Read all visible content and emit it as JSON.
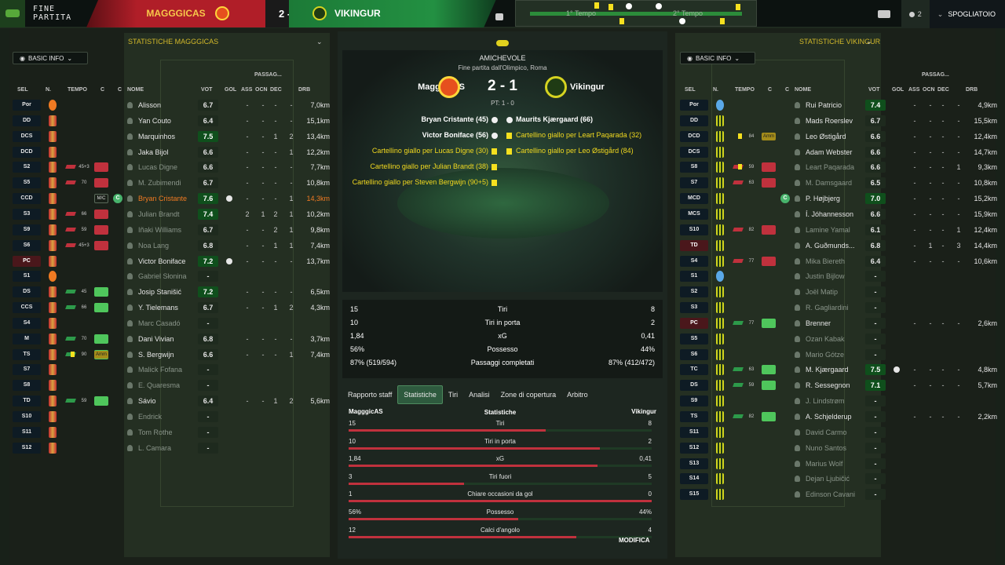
{
  "topbar": {
    "fine": "FINE PARTITA",
    "home": "MAGGGICAS",
    "score": "2 - 1",
    "away": "VIKINGUR",
    "tempo1": "1° Tempo",
    "tempo2": "2° Tempo",
    "users": "2",
    "spogliatoio": "SPOGLIATOIO"
  },
  "left": {
    "title": "STATISTICHE MAGGGICAS",
    "basic": "BASIC INFO",
    "headers": {
      "sel": "SEL",
      "n": "N.",
      "tempo": "TEMPO",
      "c1": "C",
      "c2": "C",
      "nome": "NOME",
      "vot": "VOT",
      "gol": "GOL",
      "ass": "ASS",
      "ocn": "OCN",
      "dec": "DEC",
      "drb": "DRB",
      "passagg": "PASSAG..."
    },
    "rows": [
      {
        "sel": "Por",
        "gk": true,
        "nm": "Alisson",
        "v": "6.7",
        "gol": "-",
        "ass": "-",
        "ocn": "-",
        "dec": "-",
        "drb": "7,0km"
      },
      {
        "sel": "DD",
        "nm": "Yan Couto",
        "v": "6.4",
        "gol": "-",
        "ass": "-",
        "ocn": "-",
        "dec": "-",
        "drb": "15,1km"
      },
      {
        "sel": "DCS",
        "nm": "Marquinhos",
        "v": "7.5",
        "g": true,
        "gol": "-",
        "ass": "-",
        "ocn": "1",
        "dec": "2",
        "drb": "13,4km"
      },
      {
        "sel": "DCD",
        "nm": "Jaka Bijol",
        "v": "6.6",
        "gol": "-",
        "ass": "-",
        "ocn": "-",
        "dec": "1",
        "drb": "12,2km"
      },
      {
        "sel": "S2",
        "t": "45+3",
        "out": true,
        "dim": true,
        "nm": "Lucas Digne",
        "v": "6.6",
        "gol": "-",
        "ass": "-",
        "ocn": "-",
        "dec": "-",
        "drb": "7,7km"
      },
      {
        "sel": "S5",
        "t": "70",
        "out": true,
        "dim": true,
        "nm": "M. Zubimendi",
        "v": "6.7",
        "gol": "-",
        "ass": "-",
        "ocn": "-",
        "dec": "-",
        "drb": "10,8km"
      },
      {
        "sel": "CCD",
        "mic": "M/C",
        "cap": "C",
        "hl": true,
        "nm": "Bryan Cristante",
        "v": "7.6",
        "g": true,
        "goal": true,
        "gol": "-",
        "ass": "-",
        "ocn": "-",
        "dec": "1",
        "drb": "14,3km"
      },
      {
        "sel": "S3",
        "t": "66",
        "out": true,
        "dim": true,
        "nm": "Julian Brandt",
        "v": "7.4",
        "g": true,
        "gol": "2",
        "ass": "1",
        "ocn": "2",
        "dec": "1",
        "drb": "10,2km"
      },
      {
        "sel": "S9",
        "t": "59",
        "out": true,
        "dim": true,
        "nm": "Iñaki Williams",
        "v": "6.7",
        "gol": "-",
        "ass": "-",
        "ocn": "2",
        "dec": "1",
        "drb": "9,8km"
      },
      {
        "sel": "S6",
        "t": "45+3",
        "out": true,
        "dim": true,
        "nm": "Noa Lang",
        "v": "6.8",
        "gol": "-",
        "ass": "-",
        "ocn": "1",
        "dec": "1",
        "drb": "7,4km"
      },
      {
        "sel": "PC",
        "red": true,
        "nm": "Victor Boniface",
        "v": "7.2",
        "g": true,
        "goal": true,
        "gol": "-",
        "ass": "-",
        "ocn": "-",
        "dec": "-",
        "drb": "13,7km"
      },
      {
        "sel": "S1",
        "gk": true,
        "dim": true,
        "nm": "Gabriel Słonina",
        "v": "-",
        "gol": "",
        "ass": "",
        "ocn": "",
        "dec": "",
        "drb": ""
      },
      {
        "sel": "DS",
        "t": "45",
        "in": true,
        "nm": "Josip Stanišić",
        "v": "7.2",
        "g": true,
        "gol": "-",
        "ass": "-",
        "ocn": "-",
        "dec": "-",
        "drb": "6,5km"
      },
      {
        "sel": "CCS",
        "t": "66",
        "in": true,
        "nm": "Y. Tielemans",
        "v": "6.7",
        "gol": "-",
        "ass": "-",
        "ocn": "1",
        "dec": "2",
        "drb": "4,3km"
      },
      {
        "sel": "S4",
        "dim": true,
        "nm": "Marc Casadó",
        "v": "-",
        "gol": "",
        "ass": "",
        "ocn": "",
        "dec": "",
        "drb": ""
      },
      {
        "sel": "M",
        "t": "70",
        "in": true,
        "nm": "Dani Vivian",
        "v": "6.8",
        "gol": "-",
        "ass": "-",
        "ocn": "-",
        "dec": "-",
        "drb": "3,7km"
      },
      {
        "sel": "TS",
        "t": "90",
        "in": true,
        "yc": true,
        "amm": "Amm",
        "nm": "S. Bergwijn",
        "v": "6.6",
        "gol": "-",
        "ass": "-",
        "ocn": "-",
        "dec": "1",
        "drb": "7,4km"
      },
      {
        "sel": "S7",
        "dim": true,
        "nm": "Malick Fofana",
        "v": "-",
        "gol": "",
        "ass": "",
        "ocn": "",
        "dec": "",
        "drb": ""
      },
      {
        "sel": "S8",
        "dim": true,
        "nm": "E. Quaresma",
        "v": "-",
        "gol": "",
        "ass": "",
        "ocn": "",
        "dec": "",
        "drb": ""
      },
      {
        "sel": "TD",
        "t": "59",
        "in": true,
        "nm": "Sávio",
        "v": "6.4",
        "gol": "-",
        "ass": "-",
        "ocn": "1",
        "dec": "2",
        "drb": "5,6km"
      },
      {
        "sel": "S10",
        "dim": true,
        "nm": "Endrick",
        "v": "-",
        "gol": "",
        "ass": "",
        "ocn": "",
        "dec": "",
        "drb": ""
      },
      {
        "sel": "S11",
        "dim": true,
        "nm": "Tom Rothe",
        "v": "-",
        "gol": "",
        "ass": "",
        "ocn": "",
        "dec": "",
        "drb": ""
      },
      {
        "sel": "S12",
        "dim": true,
        "nm": "L. Camara",
        "v": "-",
        "gol": "",
        "ass": "",
        "ocn": "",
        "dec": "",
        "drb": ""
      }
    ]
  },
  "right": {
    "title": "STATISTICHE VIKINGUR",
    "basic": "BASIC INFO",
    "rows": [
      {
        "sel": "Por",
        "gk": true,
        "nm": "Rui Patricio",
        "v": "7.4",
        "g": true,
        "gol": "-",
        "ass": "-",
        "ocn": "-",
        "dec": "-",
        "drb": "4,9km"
      },
      {
        "sel": "DD",
        "nm": "Mads Roerslev",
        "v": "6.7",
        "gol": "-",
        "ass": "-",
        "ocn": "-",
        "dec": "-",
        "drb": "15,5km"
      },
      {
        "sel": "DCD",
        "yc": true,
        "t": "84",
        "amm": "Amm",
        "nm": "Leo Østigård",
        "v": "6.6",
        "gol": "-",
        "ass": "-",
        "ocn": "-",
        "dec": "-",
        "drb": "12,4km"
      },
      {
        "sel": "DCS",
        "nm": "Adam Webster",
        "v": "6.6",
        "gol": "-",
        "ass": "-",
        "ocn": "-",
        "dec": "-",
        "drb": "14,7km"
      },
      {
        "sel": "S8",
        "yc": true,
        "t": "59",
        "out": true,
        "dim": true,
        "nm": "Leart Paqarada",
        "v": "6.6",
        "gol": "-",
        "ass": "-",
        "ocn": "-",
        "dec": "1",
        "drb": "9,3km"
      },
      {
        "sel": "S7",
        "t": "63",
        "out": true,
        "dim": true,
        "nm": "M. Damsgaard",
        "v": "6.5",
        "gol": "-",
        "ass": "-",
        "ocn": "-",
        "dec": "-",
        "drb": "10,8km"
      },
      {
        "sel": "MCD",
        "cap": "C",
        "nm": "P. Højbjerg",
        "v": "7.0",
        "g": true,
        "gol": "-",
        "ass": "-",
        "ocn": "-",
        "dec": "-",
        "drb": "15,2km"
      },
      {
        "sel": "MCS",
        "nm": "Í. Jóhannesson",
        "v": "6.6",
        "gol": "-",
        "ass": "-",
        "ocn": "-",
        "dec": "-",
        "drb": "15,9km"
      },
      {
        "sel": "S10",
        "t": "82",
        "out": true,
        "dim": true,
        "nm": "Lamine Yamal",
        "v": "6.1",
        "gol": "-",
        "ass": "-",
        "ocn": "-",
        "dec": "1",
        "drb": "12,4km"
      },
      {
        "sel": "TD",
        "red": true,
        "nm": "A. Guðmunds...",
        "v": "6.8",
        "gol": "-",
        "ass": "1",
        "ocn": "-",
        "dec": "3",
        "drb": "14,4km"
      },
      {
        "sel": "S4",
        "t": "77",
        "out": true,
        "dim": true,
        "nm": "Mika Biereth",
        "v": "6.4",
        "gol": "-",
        "ass": "-",
        "ocn": "-",
        "dec": "-",
        "drb": "10,6km"
      },
      {
        "sel": "S1",
        "gk": true,
        "dim": true,
        "nm": "Justin Bijlow",
        "v": "-",
        "gol": "",
        "ass": "",
        "ocn": "",
        "dec": "",
        "drb": ""
      },
      {
        "sel": "S2",
        "dim": true,
        "nm": "Joël Matip",
        "v": "-",
        "gol": "",
        "ass": "",
        "ocn": "",
        "dec": "",
        "drb": ""
      },
      {
        "sel": "S3",
        "dim": true,
        "nm": "R. Gagliardini",
        "v": "-",
        "gol": "",
        "ass": "",
        "ocn": "",
        "dec": "",
        "drb": ""
      },
      {
        "sel": "PC",
        "red": true,
        "t": "77",
        "in": true,
        "nm": "Brenner",
        "v": "-",
        "gol": "-",
        "ass": "-",
        "ocn": "-",
        "dec": "-",
        "drb": "2,6km"
      },
      {
        "sel": "S5",
        "dim": true,
        "nm": "Ozan Kabak",
        "v": "-",
        "gol": "",
        "ass": "",
        "ocn": "",
        "dec": "",
        "drb": ""
      },
      {
        "sel": "S6",
        "dim": true,
        "nm": "Mario Gótze",
        "v": "-",
        "gol": "",
        "ass": "",
        "ocn": "",
        "dec": "",
        "drb": ""
      },
      {
        "sel": "TC",
        "t": "63",
        "in": true,
        "nm": "M. Kjærgaard",
        "v": "7.5",
        "g": true,
        "goal": true,
        "gol": "-",
        "ass": "-",
        "ocn": "-",
        "dec": "-",
        "drb": "4,8km"
      },
      {
        "sel": "DS",
        "t": "59",
        "in": true,
        "nm": "R. Sessegnon",
        "v": "7.1",
        "g": true,
        "gol": "-",
        "ass": "-",
        "ocn": "-",
        "dec": "-",
        "drb": "5,7km"
      },
      {
        "sel": "S9",
        "dim": true,
        "nm": "J. Lindstrøm",
        "v": "-",
        "gol": "",
        "ass": "",
        "ocn": "",
        "dec": "",
        "drb": ""
      },
      {
        "sel": "TS",
        "t": "82",
        "in": true,
        "nm": "A. Schjelderup",
        "v": "-",
        "gol": "-",
        "ass": "-",
        "ocn": "-",
        "dec": "-",
        "drb": "2,2km"
      },
      {
        "sel": "S11",
        "dim": true,
        "nm": "David Carmo",
        "v": "-",
        "gol": "",
        "ass": "",
        "ocn": "",
        "dec": "",
        "drb": ""
      },
      {
        "sel": "S12",
        "dim": true,
        "nm": "Nuno Santos",
        "v": "-",
        "gol": "",
        "ass": "",
        "ocn": "",
        "dec": "",
        "drb": ""
      },
      {
        "sel": "S13",
        "dim": true,
        "nm": "Marius Wolf",
        "v": "-",
        "gol": "",
        "ass": "",
        "ocn": "",
        "dec": "",
        "drb": ""
      },
      {
        "sel": "S14",
        "dim": true,
        "nm": "Dejan Ljubičić",
        "v": "-",
        "gol": "",
        "ass": "",
        "ocn": "",
        "dec": "",
        "drb": ""
      },
      {
        "sel": "S15",
        "dim": true,
        "nm": "Edinson Cavani",
        "v": "-",
        "gol": "",
        "ass": "",
        "ocn": "",
        "dec": "",
        "drb": ""
      }
    ]
  },
  "match": {
    "competition": "AMICHEVOLE",
    "subtitle": "Fine partita dall'Olimpico, Roma",
    "home": "MagggicAS",
    "away": "Vikingur",
    "score": "2 - 1",
    "ht": "PT: 1 - 0",
    "events_left": [
      {
        "t": "Bryan Cristante (45)",
        "k": "goal"
      },
      {
        "t": "Victor Boniface (56)",
        "k": "goal"
      },
      {
        "t": "Cartellino giallo per Lucas Digne (30)",
        "k": "card"
      },
      {
        "t": "Cartellino giallo per Julian Brandt (38)",
        "k": "card"
      },
      {
        "t": "Cartellino giallo per Steven Bergwijn (90+5)",
        "k": "card"
      }
    ],
    "events_right": [
      {
        "t": "Maurits Kjærgaard (66)",
        "k": "goal"
      },
      {
        "t": "Cartellino giallo per Leart Paqarada (32)",
        "k": "card"
      },
      {
        "t": "Cartellino giallo per Leo Østigård (84)",
        "k": "card"
      }
    ],
    "summary": [
      {
        "l": "15",
        "m": "Tiri",
        "r": "8"
      },
      {
        "l": "10",
        "m": "Tiri in porta",
        "r": "2"
      },
      {
        "l": "1,84",
        "m": "xG",
        "r": "0,41"
      },
      {
        "l": "56%",
        "m": "Possesso",
        "r": "44%"
      },
      {
        "l": "87% (519/594)",
        "m": "Passaggi completati",
        "r": "87% (412/472)"
      }
    ],
    "tabs": [
      "Rapporto staff",
      "Statistiche",
      "Tiri",
      "Analisi",
      "Zone di copertura",
      "Arbitro"
    ],
    "stats_head": {
      "home": "MagggicAS",
      "mid": "Statistiche",
      "away": "Vikingur"
    },
    "stats": [
      {
        "l": "15",
        "m": "Tiri",
        "r": "8",
        "f": 0.65
      },
      {
        "l": "10",
        "m": "Tiri in porta",
        "r": "2",
        "f": 0.83
      },
      {
        "l": "1,84",
        "m": "xG",
        "r": "0,41",
        "f": 0.82
      },
      {
        "l": "3",
        "m": "Tiri fuori",
        "r": "5",
        "f": 0.38
      },
      {
        "l": "1",
        "m": "Chiare occasioni da gol",
        "r": "0",
        "f": 1.0
      },
      {
        "l": "56%",
        "m": "Possesso",
        "r": "44%",
        "f": 0.56
      },
      {
        "l": "12",
        "m": "Calci d'angolo",
        "r": "4",
        "f": 0.75
      }
    ],
    "modifica": "MODIFICA"
  }
}
